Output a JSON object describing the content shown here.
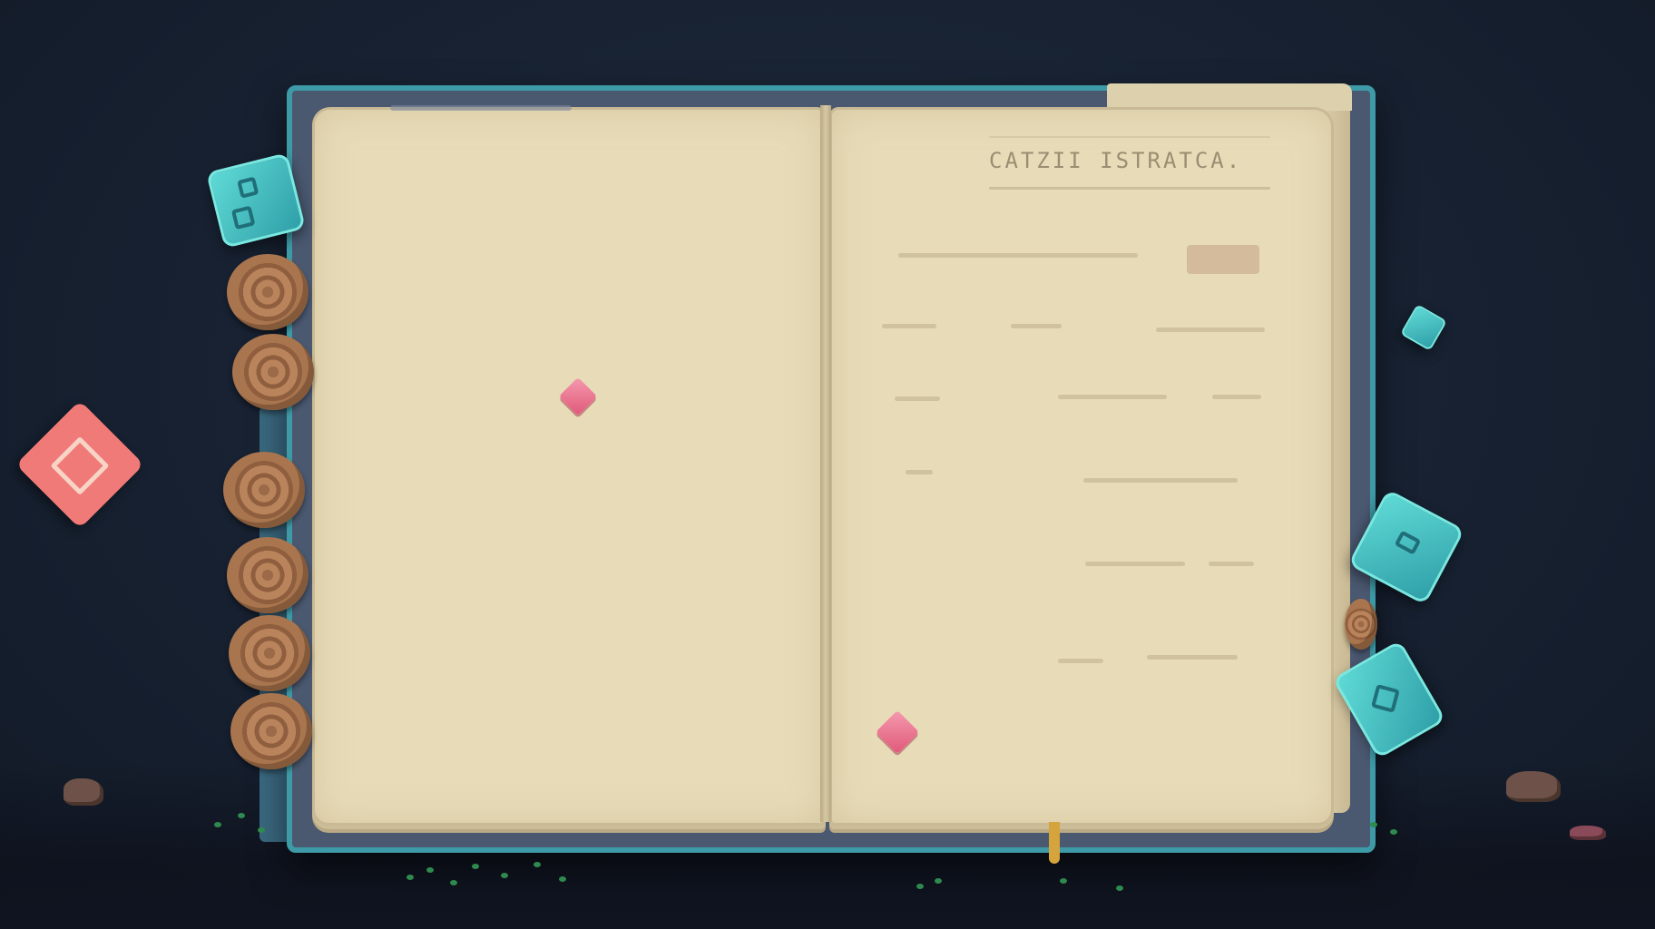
{
  "book": {
    "right_page_title": "CATZII ISTRATCA."
  },
  "colors": {
    "background": "#172131",
    "page": "#e8dcb8",
    "cover_edge": "#3d9aa6",
    "gem_pink": "#e0587a",
    "dice_teal": "#4fc9c9",
    "rune_coral": "#f07a78",
    "log_brown": "#a8754f"
  },
  "icons": {
    "rune_tile": "diamond-rune-icon",
    "dice": "dice-icon",
    "gem": "gem-icon",
    "log": "wood-log-icon"
  }
}
